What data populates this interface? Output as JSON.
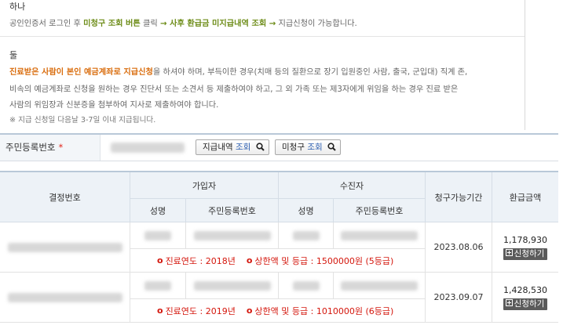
{
  "guide": {
    "section1": {
      "title": "하나",
      "line_parts": [
        {
          "text": "공인인증서 로그인 후 ",
          "style": "normal"
        },
        {
          "text": "미청구 조회 버튼",
          "style": "green"
        },
        {
          "text": " 클릭 ",
          "style": "normal"
        },
        {
          "text": "→ 사후 환급금 미지급내역 조회 →",
          "style": "green"
        },
        {
          "text": " 지급신청이 가능합니다.",
          "style": "normal"
        }
      ]
    },
    "section2": {
      "title": "둘",
      "line1_highlight1": "진료받은 사람이 본인 예금계좌로 지급신청",
      "line1_rest": "을 하셔야 하며, 부득이한 경우(치매 등의 질환으로 장기 입원중인 사람, 출국, 군입대) 직계 존,",
      "line2": "비속의 예금계좌로 신청을 원하는 경우 진단서 또는 소견서 등 제출하여야 하고, 그 외 가족 또는 제3자에게 위임을 하는 경우 진료 받은",
      "line3": "사람의 위임장과 신분증을 첨부하여 지사로 제출하여야 합니다.",
      "note": "※ 지급 신청일 다음날 3-7일 이내 지급됩니다."
    }
  },
  "id_row": {
    "label": "주민등록번호",
    "required_mark": "*",
    "btn_paid_prefix": "지급내역 ",
    "btn_paid_blue": "조회",
    "btn_unclaimed_prefix": "미청구 ",
    "btn_unclaimed_blue": "조회"
  },
  "table": {
    "headers": {
      "decision_no": "결정번호",
      "subscriber": "가입자",
      "patient": "수진자",
      "name": "성명",
      "resident_no": "주민등록번호",
      "claim_period": "청구가능기간",
      "refund_amount": "환급금액"
    },
    "rows": [
      {
        "claim_deadline": "2023.08.06",
        "refund": "1,178,930",
        "apply_label": "신청하기",
        "year_label": "진료연도 : 2018년",
        "limit_label": "상한액 및 등급 : 1500000원 (5등급)"
      },
      {
        "claim_deadline": "2023.09.07",
        "refund": "1,428,530",
        "apply_label": "신청하기",
        "year_label": "진료연도 : 2019년",
        "limit_label": "상한액 및 등급 : 1010000원 (6등급)"
      }
    ],
    "bullet": "o"
  },
  "colors": {
    "highlight_green": "#6d8c18",
    "highlight_orange": "#d96c0c",
    "notice_red": "#d4160c",
    "header_bg": "#edf2f7",
    "apply_button_bg": "#5b5b5b"
  }
}
